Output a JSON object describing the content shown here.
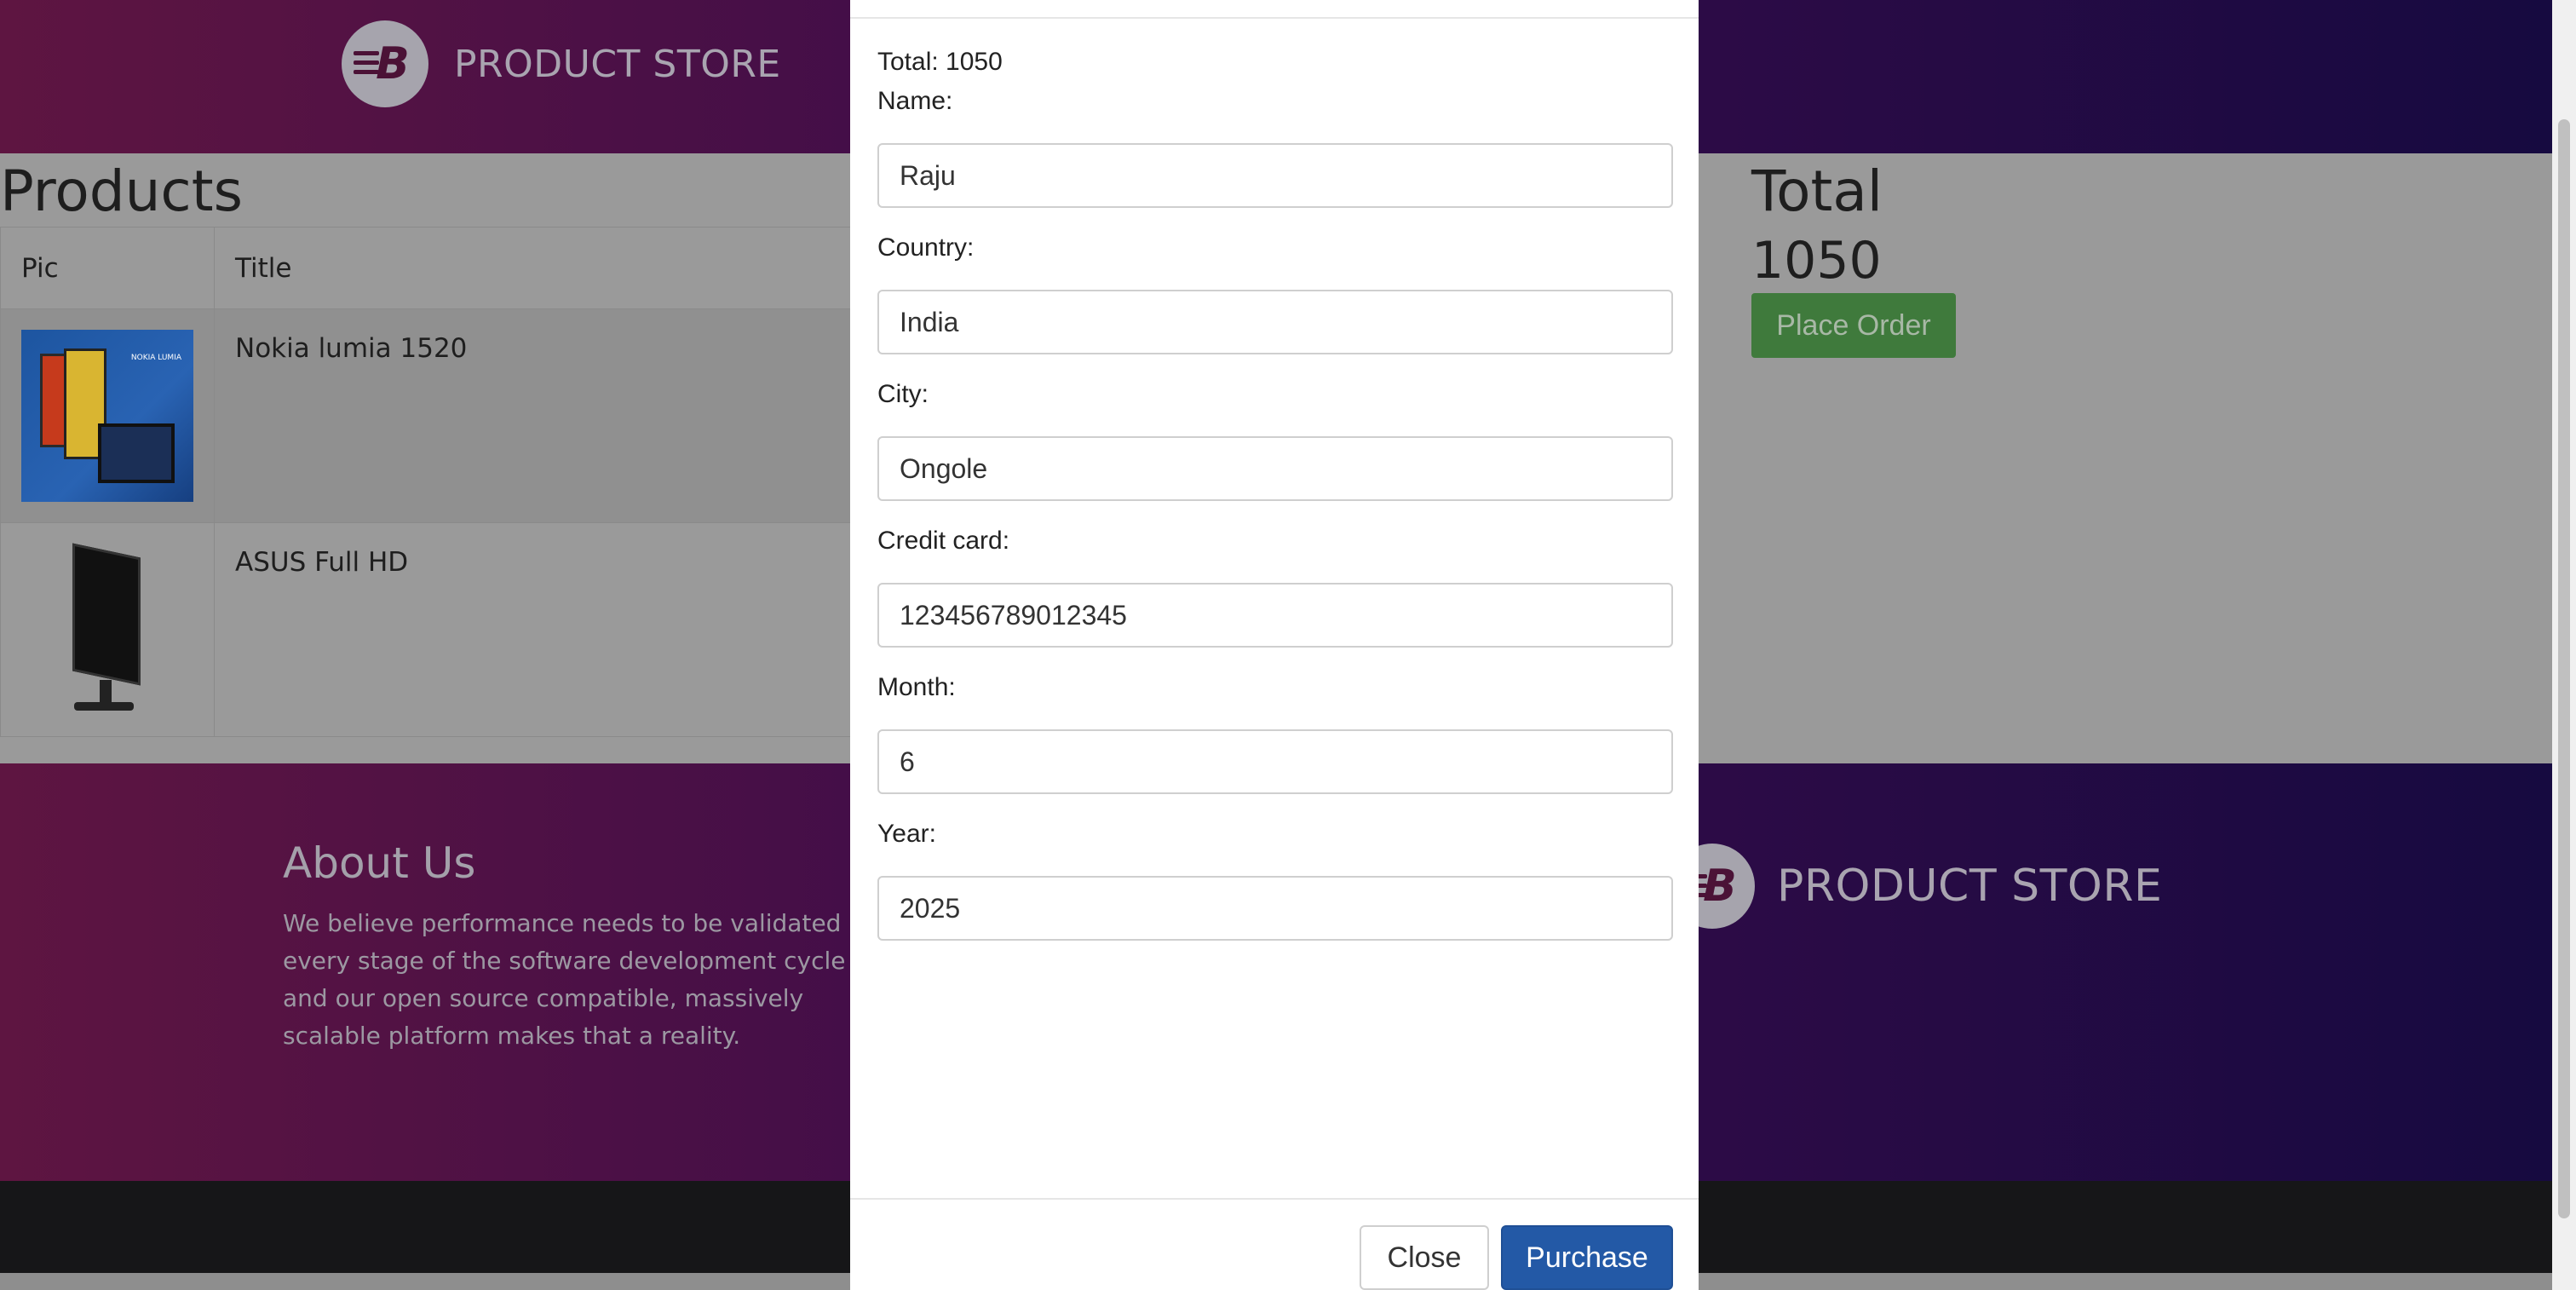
{
  "navbar": {
    "brand_name": "PRODUCT STORE"
  },
  "products": {
    "title": "Products",
    "columns": [
      "Pic",
      "Title"
    ],
    "rows": [
      {
        "title": "Nokia lumia 1520",
        "image": "nokia-lumia-image"
      },
      {
        "title": "ASUS Full HD",
        "image": "asus-monitor-image"
      }
    ]
  },
  "total": {
    "label": "Total",
    "value": "1050",
    "place_order_label": "Place Order"
  },
  "footer": {
    "about_title": "About Us",
    "about_text": "We believe performance needs to be validated at every stage of the software development cycle and our open source compatible, massively scalable platform makes that a reality.",
    "brand_name": "PRODUCT STORE"
  },
  "modal": {
    "total_text": "Total: 1050",
    "fields": {
      "name": {
        "label": "Name:",
        "value": "Raju"
      },
      "country": {
        "label": "Country:",
        "value": "India"
      },
      "city": {
        "label": "City:",
        "value": "Ongole"
      },
      "card": {
        "label": "Credit card:",
        "value": "123456789012345"
      },
      "month": {
        "label": "Month:",
        "value": "6"
      },
      "year": {
        "label": "Year:",
        "value": "2025"
      }
    },
    "close_label": "Close",
    "purchase_label": "Purchase"
  },
  "colors": {
    "navbar_start": "#5e1541",
    "navbar_end": "#160a40",
    "purchase": "#2359a6",
    "place_order": "#3f7a3c"
  }
}
